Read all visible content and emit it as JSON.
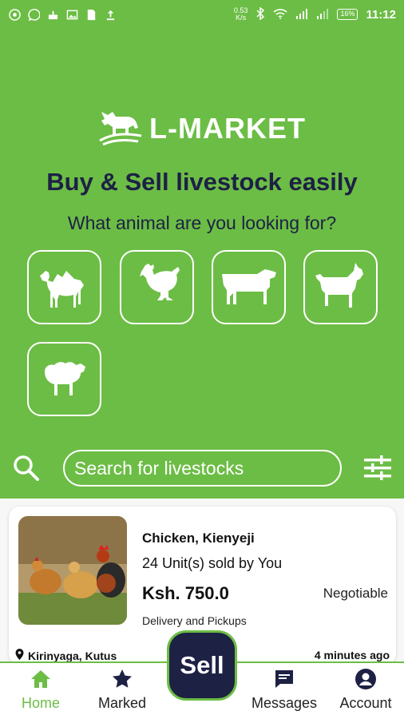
{
  "status_bar": {
    "net_speed_value": "0.53",
    "net_speed_unit": "K/s",
    "battery": "16%",
    "time": "11:12"
  },
  "brand": {
    "name": "L-MARKET"
  },
  "headline": "Buy & Sell livestock easily",
  "subheadline": "What animal are you looking for?",
  "categories": [
    {
      "icon": "camel-icon"
    },
    {
      "icon": "chicken-icon"
    },
    {
      "icon": "cow-icon"
    },
    {
      "icon": "goat-icon"
    },
    {
      "icon": "sheep-icon"
    }
  ],
  "search": {
    "placeholder": "Search for livestocks"
  },
  "listing": {
    "title": "Chicken, Kienyeji",
    "units": "24 Unit(s) sold by You",
    "price": "Ksh. 750.0",
    "negotiable": "Negotiable",
    "delivery": "Delivery and Pickups",
    "location": "Kirinyaga, Kutus",
    "time": "4 minutes ago"
  },
  "nav": {
    "home": "Home",
    "marked": "Marked",
    "sell": "Sell",
    "messages": "Messages",
    "account": "Account"
  },
  "colors": {
    "brand_green": "#6cbd45",
    "navy": "#1d2144"
  }
}
